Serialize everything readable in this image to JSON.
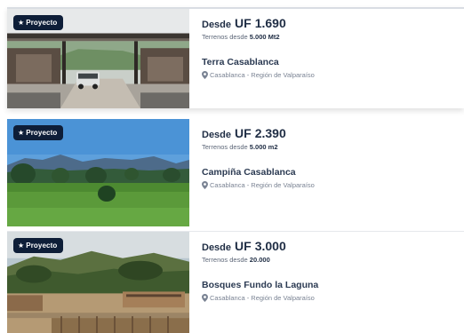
{
  "listings": [
    {
      "badge": "Proyecto",
      "price_prefix": "Desde",
      "price_unit": "UF",
      "price_value": "1.690",
      "terrain_label": "Terrenos desde",
      "terrain_value": "5.000 Mt2",
      "title": "Terra Casablanca",
      "location": "Casablanca - Región de Valparaíso"
    },
    {
      "badge": "Proyecto",
      "price_prefix": "Desde",
      "price_unit": "UF",
      "price_value": "2.390",
      "terrain_label": "Terrenos desde",
      "terrain_value": "5.000 m2",
      "title": "Campiña Casablanca",
      "location": "Casablanca - Región de Valparaíso"
    },
    {
      "badge": "Proyecto",
      "price_prefix": "Desde",
      "price_unit": "UF",
      "price_value": "3.000",
      "terrain_label": "Terrenos desde",
      "terrain_value": "20.000",
      "title": "Bosques Fundo la Laguna",
      "location": "Casablanca - Región de Valparaíso"
    }
  ],
  "icons": {
    "badge_icon": "star-icon",
    "location_icon": "map-pin-icon"
  },
  "colors": {
    "badge_bg": "#0e1e38",
    "text": "#1f2d44",
    "muted": "#7a8393"
  }
}
